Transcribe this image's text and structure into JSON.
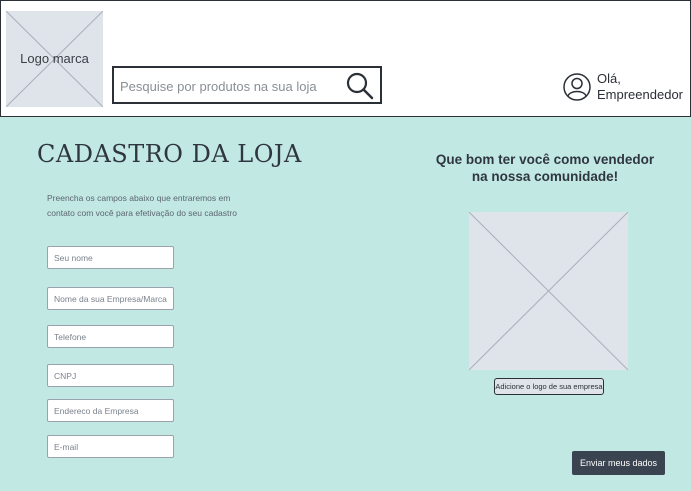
{
  "header": {
    "logo_label": "Logo marca",
    "search_placeholder": "Pesquise por produtos na sua loja",
    "user_greeting_line1": "Olá,",
    "user_greeting_line2": "Empreendedor"
  },
  "main": {
    "title": "CADASTRO DA LOJA",
    "description_line1": "Preencha os campos abaixo que entraremos em",
    "description_line2": "contato com você  para efetivação do seu cadastro",
    "fields": {
      "name": "Seu nome",
      "company": "Nome da sua Empresa/Marca",
      "phone": "Telefone",
      "cnpj": "CNPJ",
      "address": "Endereco da Empresa",
      "email": "E-mail"
    },
    "welcome_line1": "Que bom ter você como vendedor",
    "welcome_line2": "na  nossa comunidade!",
    "add_logo_label": "Adicione o logo de sua empresa",
    "submit_label": "Enviar meus dados"
  },
  "colors": {
    "background": "#c2e8e3",
    "header_bg": "#ffffff",
    "placeholder_bg": "#dfe3ea",
    "button_bg": "#3a4350",
    "text_dark": "#2f3640"
  },
  "icons": {
    "search": "search-icon",
    "user": "user-icon",
    "placeholder": "image-placeholder-icon"
  }
}
